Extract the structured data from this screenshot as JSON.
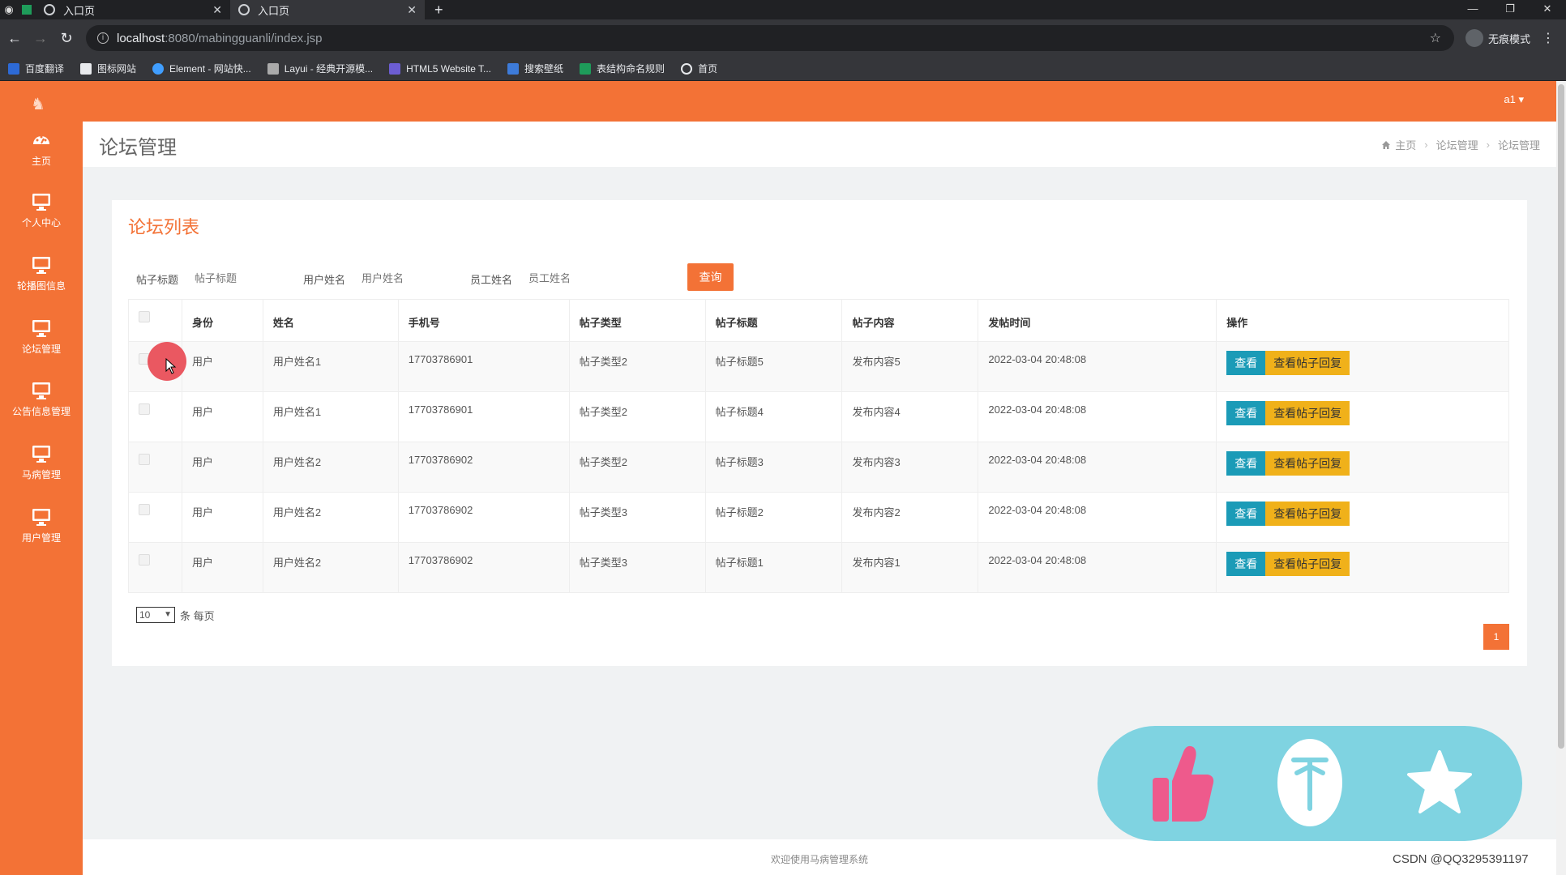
{
  "browser": {
    "tabs": [
      {
        "title": "入口页"
      },
      {
        "title": "入口页"
      }
    ],
    "url_host": "localhost",
    "url_path": ":8080/mabingguanli/index.jsp",
    "incognito_label": "无痕模式",
    "bookmarks": [
      {
        "label": "百度翻译",
        "icon": "baidu-translate-icon",
        "color": "#2d6ad6"
      },
      {
        "label": "图标网站",
        "icon": "flag-icon",
        "color": "#e8eaed"
      },
      {
        "label": "Element - 网站快...",
        "icon": "element-icon",
        "color": "#409eff"
      },
      {
        "label": "Layui - 经典开源模...",
        "icon": "layui-icon",
        "color": "#aaaaaa"
      },
      {
        "label": "HTML5 Website T...",
        "icon": "html5-icon",
        "color": "#6c5dd3"
      },
      {
        "label": "搜索壁纸",
        "icon": "wallpaper-icon",
        "color": "#3d7bd9"
      },
      {
        "label": "表结构命名规则",
        "icon": "doc-icon",
        "color": "#1e9c5a"
      },
      {
        "label": "首页",
        "icon": "globe-icon",
        "color": "#e8eaed"
      }
    ]
  },
  "app": {
    "user": "a1 ▾",
    "sidebar": [
      {
        "label": "主页",
        "icon": "dashboard-icon"
      },
      {
        "label": "个人中心",
        "icon": "monitor-icon"
      },
      {
        "label": "轮播图信息",
        "icon": "monitor-icon"
      },
      {
        "label": "论坛管理",
        "icon": "monitor-icon"
      },
      {
        "label": "公告信息管理",
        "icon": "monitor-icon"
      },
      {
        "label": "马病管理",
        "icon": "monitor-icon"
      },
      {
        "label": "用户管理",
        "icon": "monitor-icon"
      }
    ],
    "page_title": "论坛管理",
    "breadcrumb": [
      "主页",
      "论坛管理",
      "论坛管理"
    ],
    "card_title": "论坛列表",
    "search": {
      "fields": [
        {
          "label": "帖子标题",
          "placeholder": "帖子标题"
        },
        {
          "label": "用户姓名",
          "placeholder": "用户姓名"
        },
        {
          "label": "员工姓名",
          "placeholder": "员工姓名"
        }
      ],
      "button": "查询"
    },
    "table": {
      "columns": [
        "身份",
        "姓名",
        "手机号",
        "帖子类型",
        "帖子标题",
        "帖子内容",
        "发帖时间",
        "操作"
      ],
      "rows": [
        {
          "role": "用户",
          "name": "用户姓名1",
          "phone": "17703786901",
          "type": "帖子类型2",
          "title": "帖子标题5",
          "content": "发布内容5",
          "time": "2022-03-04 20:48:08"
        },
        {
          "role": "用户",
          "name": "用户姓名1",
          "phone": "17703786901",
          "type": "帖子类型2",
          "title": "帖子标题4",
          "content": "发布内容4",
          "time": "2022-03-04 20:48:08"
        },
        {
          "role": "用户",
          "name": "用户姓名2",
          "phone": "17703786902",
          "type": "帖子类型2",
          "title": "帖子标题3",
          "content": "发布内容3",
          "time": "2022-03-04 20:48:08"
        },
        {
          "role": "用户",
          "name": "用户姓名2",
          "phone": "17703786902",
          "type": "帖子类型3",
          "title": "帖子标题2",
          "content": "发布内容2",
          "time": "2022-03-04 20:48:08"
        },
        {
          "role": "用户",
          "name": "用户姓名2",
          "phone": "17703786902",
          "type": "帖子类型3",
          "title": "帖子标题1",
          "content": "发布内容1",
          "time": "2022-03-04 20:48:08"
        }
      ],
      "view_label": "查看",
      "reply_label": "查看帖子回复"
    },
    "pagination": {
      "page_size": "10",
      "page_size_suffix": "条 每页",
      "current_page": "1"
    },
    "footer": "欢迎使用马病管理系统"
  },
  "watermark": "CSDN @QQ3295391197",
  "colors": {
    "brand": "#f37236",
    "view_button": "#1b9bb7",
    "reply_button": "#f0b11a",
    "float_panel": "#7fd3e1",
    "like": "#ee5a8c"
  }
}
